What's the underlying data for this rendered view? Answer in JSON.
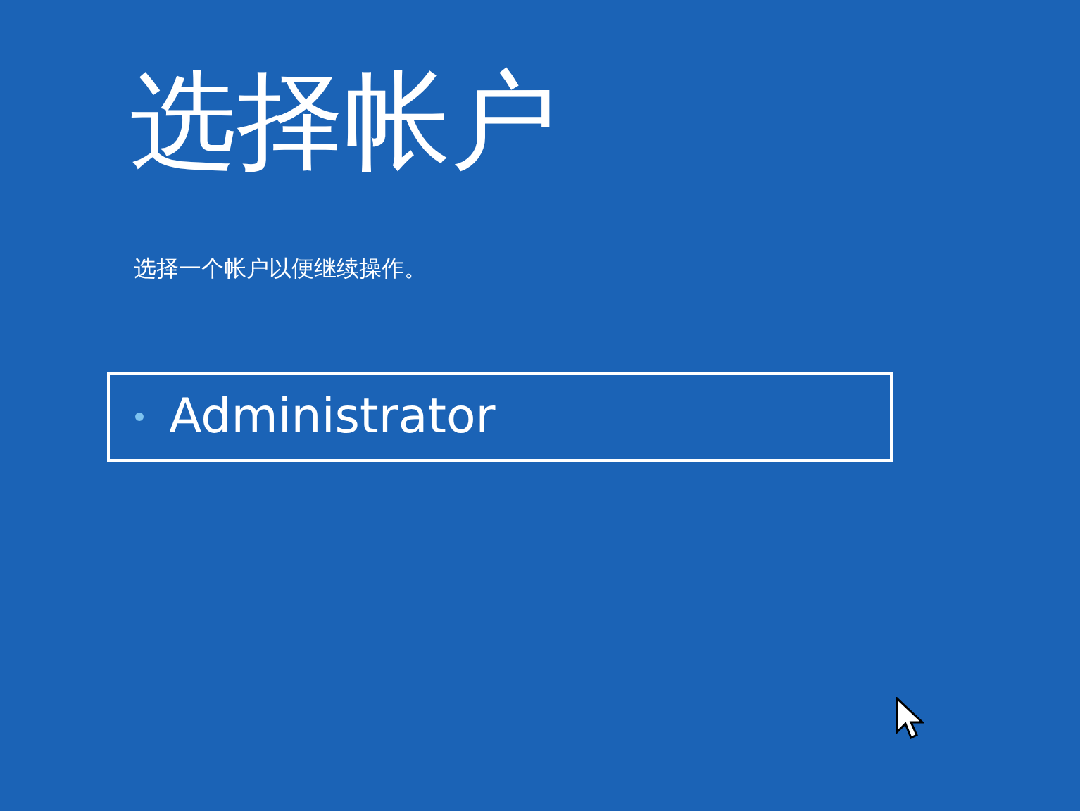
{
  "title": "选择帐户",
  "subtitle": "选择一个帐户以便继续操作。",
  "accounts": [
    {
      "name": "Administrator",
      "selected": true
    }
  ]
}
